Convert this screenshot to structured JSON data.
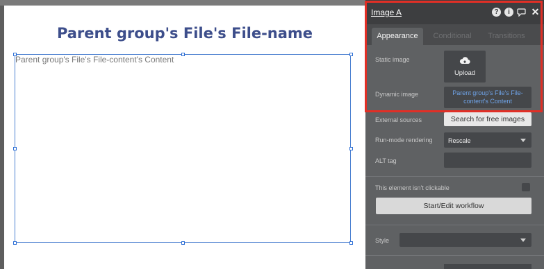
{
  "canvas": {
    "title": "Parent group's File's File-name",
    "image_text": "Parent group's File's File-content's Content"
  },
  "panel": {
    "title": "Image A",
    "icons": [
      "help-icon",
      "info-icon",
      "comment-icon",
      "close-icon"
    ],
    "tabs": [
      {
        "label": "Appearance",
        "active": true
      },
      {
        "label": "Conditional",
        "active": false
      },
      {
        "label": "Transitions",
        "active": false
      }
    ],
    "static_image_label": "Static image",
    "upload_label": "Upload",
    "dynamic_image_label": "Dynamic image",
    "dynamic_image_value": "Parent group's File's File-content's Content",
    "external_sources_label": "External sources",
    "search_free_images_label": "Search for free images",
    "run_mode_label": "Run-mode rendering",
    "run_mode_value": "Rescale",
    "alt_tag_label": "ALT tag",
    "alt_tag_value": "",
    "not_clickable_label": "This element isn't clickable",
    "not_clickable_checked": false,
    "workflow_button_label": "Start/Edit workflow",
    "style_label": "Style",
    "style_value": ""
  },
  "colors": {
    "title_color": "#3d4e8b",
    "selection_color": "#2d6fd6",
    "highlight_color": "#e12f26",
    "link_color": "#6fa3e8"
  }
}
